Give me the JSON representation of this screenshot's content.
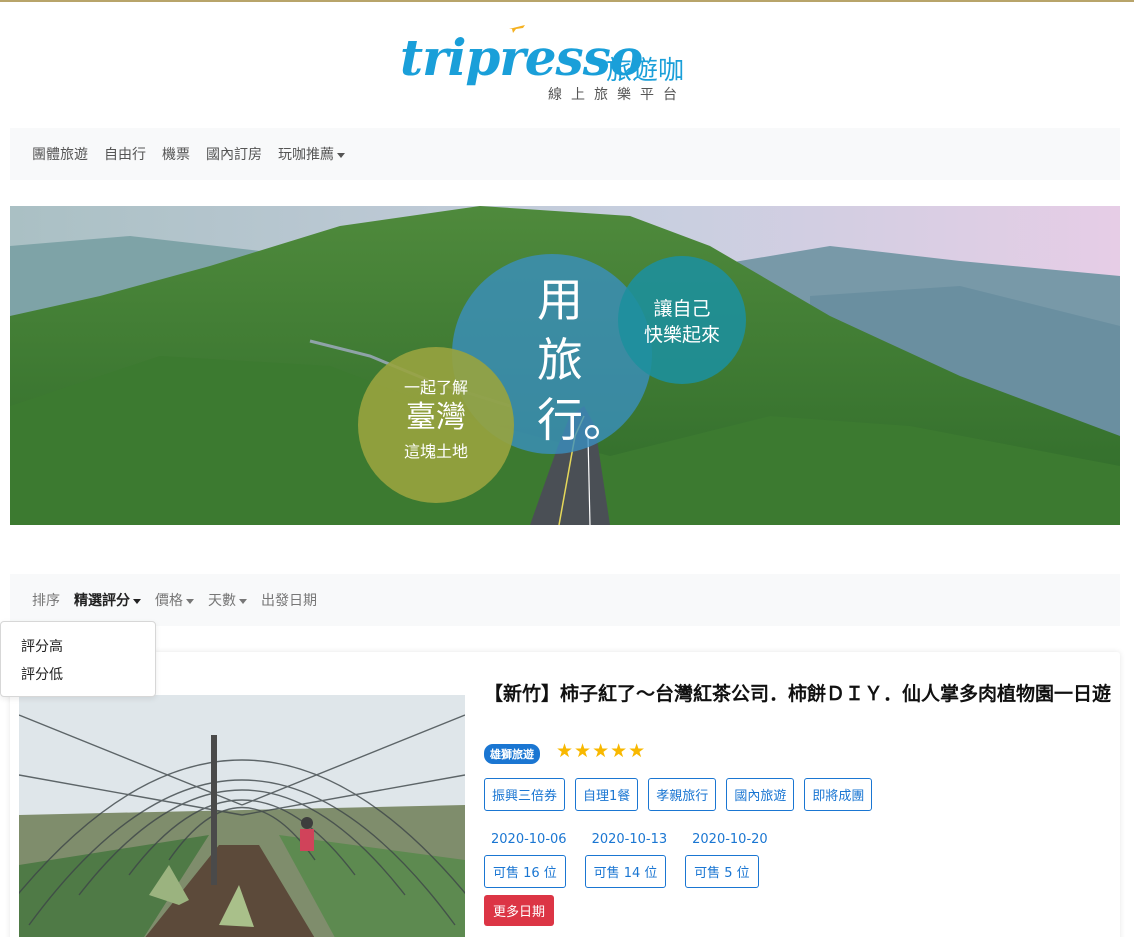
{
  "logo": {
    "wordmark": "tripresso",
    "cn_name": "旅遊咖",
    "tagline": "線上旅樂平台",
    "brand_color": "#1a9fd9",
    "accent_color": "#f5b120"
  },
  "nav": {
    "items": [
      "團體旅遊",
      "自由行",
      "機票",
      "國內訂房"
    ],
    "dropdown_label": "玩咖推薦"
  },
  "banner": {
    "circle_main": [
      "用",
      "旅",
      "行。"
    ],
    "circle_left": {
      "line1": "一起了解",
      "line2": "臺灣",
      "line3": "這塊土地"
    },
    "circle_right": {
      "line1": "讓自己",
      "line2": "快樂起來"
    }
  },
  "sort": {
    "label": "排序",
    "active": "精選評分",
    "price": "價格",
    "days": "天數",
    "departure": "出發日期"
  },
  "dropdown": {
    "items": [
      "評分高",
      "評分低"
    ]
  },
  "tour": {
    "title": "【新竹】柿子紅了～台灣紅茶公司．柿餅ＤＩＹ．仙人掌多肉植物園一日遊",
    "agency": "雄獅旅遊",
    "rating": 5,
    "stars_text": "★★★★★",
    "tags": [
      "振興三倍券",
      "自理1餐",
      "孝親旅行",
      "國內旅遊",
      "即將成團"
    ],
    "dates": [
      {
        "date": "2020-10-06",
        "avail": "可售 16 位"
      },
      {
        "date": "2020-10-13",
        "avail": "可售 14 位"
      },
      {
        "date": "2020-10-20",
        "avail": "可售 5 位"
      }
    ],
    "more_label": "更多日期"
  },
  "colors": {
    "primary": "#1a76d2",
    "danger": "#dc3545",
    "star": "#f8b800"
  }
}
